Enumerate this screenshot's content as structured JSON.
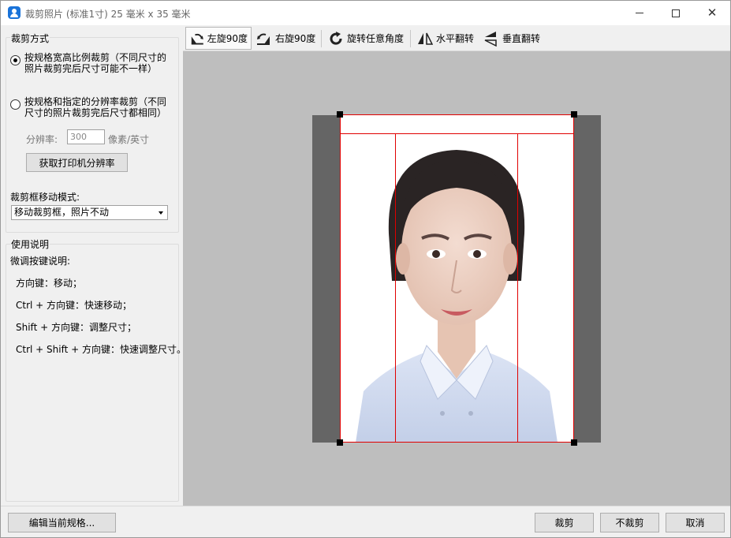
{
  "window": {
    "title": "裁剪照片 (标准1寸) 25 毫米 x 35 毫米"
  },
  "crop_mode": {
    "group_title": "裁剪方式",
    "option_ratio": "按规格宽高比例裁剪（不同尺寸的照片裁剪完后尺寸可能不一样）",
    "option_resolution": "按规格和指定的分辨率裁剪（不同尺寸的照片裁剪完后尺寸都相同）",
    "selected": "ratio",
    "resolution_label": "分辨率:",
    "resolution_value": "300",
    "resolution_unit": "像素/英寸",
    "printer_button": "获取打印机分辨率",
    "move_mode_label": "裁剪框移动模式:",
    "move_mode_value": "移动裁剪框，照片不动"
  },
  "instructions": {
    "group_title": "使用说明",
    "heading": "微调按键说明:",
    "items": [
      "方向键：移动；",
      "Ctrl + 方向键：快速移动；",
      "Shift + 方向键：调整尺寸；",
      "Ctrl + Shift + 方向键：快速调整尺寸。"
    ]
  },
  "toolbar": {
    "rotate_left": "左旋90度",
    "rotate_right": "右旋90度",
    "rotate_any": "旋转任意角度",
    "flip_horizontal": "水平翻转",
    "flip_vertical": "垂直翻转"
  },
  "buttons": {
    "edit_spec": "编辑当前规格...",
    "crop": "裁剪",
    "no_crop": "不裁剪",
    "cancel": "取消"
  },
  "colors": {
    "crop_line": "#e00000",
    "canvas_bg": "#bebebe",
    "photo_outside": "#656565",
    "app_icon": "#1a73d9"
  }
}
